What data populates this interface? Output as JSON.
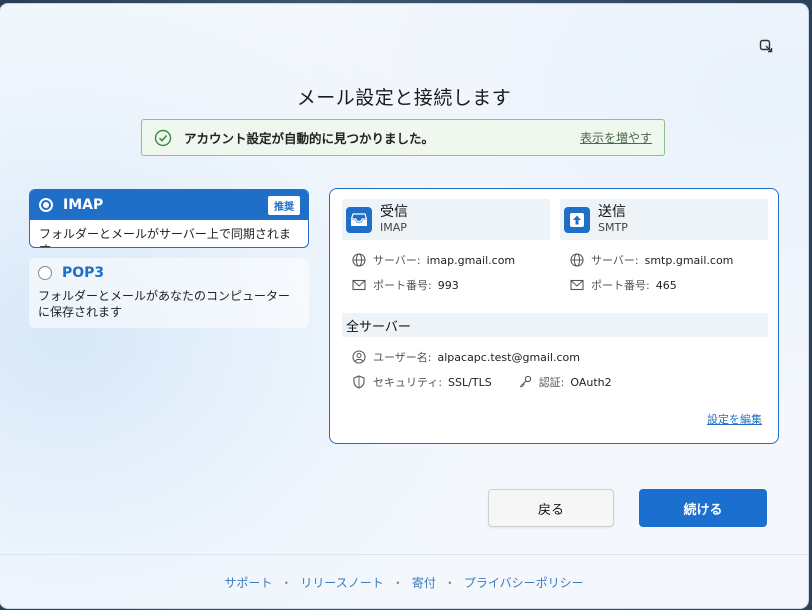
{
  "title": "メール設定と接続します",
  "banner": {
    "message": "アカウント設定が自動的に見つかりました。",
    "link": "表示を増やす",
    "icon": "check-circle-icon"
  },
  "protocols": {
    "imap": {
      "label": "IMAP",
      "badge": "推奨",
      "desc": "フォルダーとメールがサーバー上で同期されます",
      "selected": true
    },
    "pop3": {
      "label": "POP3",
      "desc": "フォルダーとメールがあなたのコンピューターに保存されます",
      "selected": false
    }
  },
  "incoming": {
    "title": "受信",
    "protocol": "IMAP",
    "server_label": "サーバー:",
    "server": "imap.gmail.com",
    "port_label": "ポート番号:",
    "port": "993"
  },
  "outgoing": {
    "title": "送信",
    "protocol": "SMTP",
    "server_label": "サーバー:",
    "server": "smtp.gmail.com",
    "port_label": "ポート番号:",
    "port": "465"
  },
  "all_servers": {
    "title": "全サーバー",
    "username_label": "ユーザー名:",
    "username": "alpacapc.test@gmail.com",
    "security_label": "セキュリティ:",
    "security": "SSL/TLS",
    "auth_label": "認証:",
    "auth": "OAuth2",
    "edit_link": "設定を編集"
  },
  "buttons": {
    "back": "戻る",
    "continue": "続ける"
  },
  "footer": {
    "support": "サポート",
    "release_notes": "リリースノート",
    "donate": "寄付",
    "privacy": "プライバシーポリシー",
    "separator": "・"
  },
  "colors": {
    "accent": "#1f6fc8",
    "success": "#3c8a3c"
  }
}
